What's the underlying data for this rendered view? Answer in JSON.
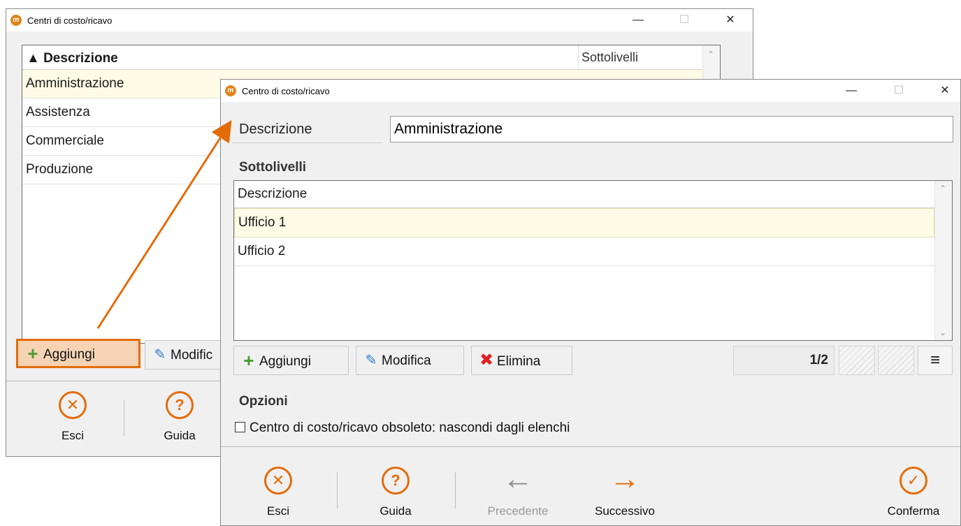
{
  "back_window": {
    "title": "Centri di costo/ricavo",
    "window_controls": {
      "minimize": "—",
      "maximize": "☐",
      "close": "✕"
    },
    "grid": {
      "columns": [
        "▲ Descrizione",
        "Sottolivelli"
      ],
      "rows": [
        "Amministrazione",
        "Assistenza",
        "Commerciale",
        "Produzione"
      ]
    },
    "buttons": {
      "add": "Aggiungi",
      "edit": "Modific"
    },
    "footer": {
      "exit": "Esci",
      "help": "Guida"
    }
  },
  "front_window": {
    "title": "Centro di costo/ricavo",
    "window_controls": {
      "minimize": "—",
      "maximize": "☐",
      "close": "✕"
    },
    "description_label": "Descrizione",
    "description_value": "Amministrazione",
    "sublevels_title": "Sottolivelli",
    "grid": {
      "column": "Descrizione",
      "rows": [
        "Ufficio 1",
        "Ufficio 2"
      ]
    },
    "buttons": {
      "add": "Aggiungi",
      "edit": "Modifica",
      "delete": "Elimina"
    },
    "pager": "1/2",
    "menu_icon": "≡",
    "options_title": "Opzioni",
    "obsolete_checkbox": {
      "label": "Centro di costo/ricavo obsoleto: nascondi dagli elenchi",
      "checked": false
    },
    "footer": {
      "exit": "Esci",
      "help": "Guida",
      "previous": "Precedente",
      "next": "Successivo",
      "confirm": "Conferma"
    }
  },
  "icons": {
    "exit": "x-circle-icon",
    "help": "question-circle-icon",
    "previous": "arrow-left-icon",
    "next": "arrow-right-icon",
    "confirm": "check-circle-icon",
    "add": "plus-icon",
    "edit": "edit-icon",
    "delete": "x-icon"
  },
  "colors": {
    "accent": "#e36c09",
    "selected_row": "#fdfbe5",
    "add_green": "#4a9a33",
    "delete_red": "#e02020",
    "edit_blue": "#2e7bc9",
    "disabled": "#9a9a9a"
  }
}
